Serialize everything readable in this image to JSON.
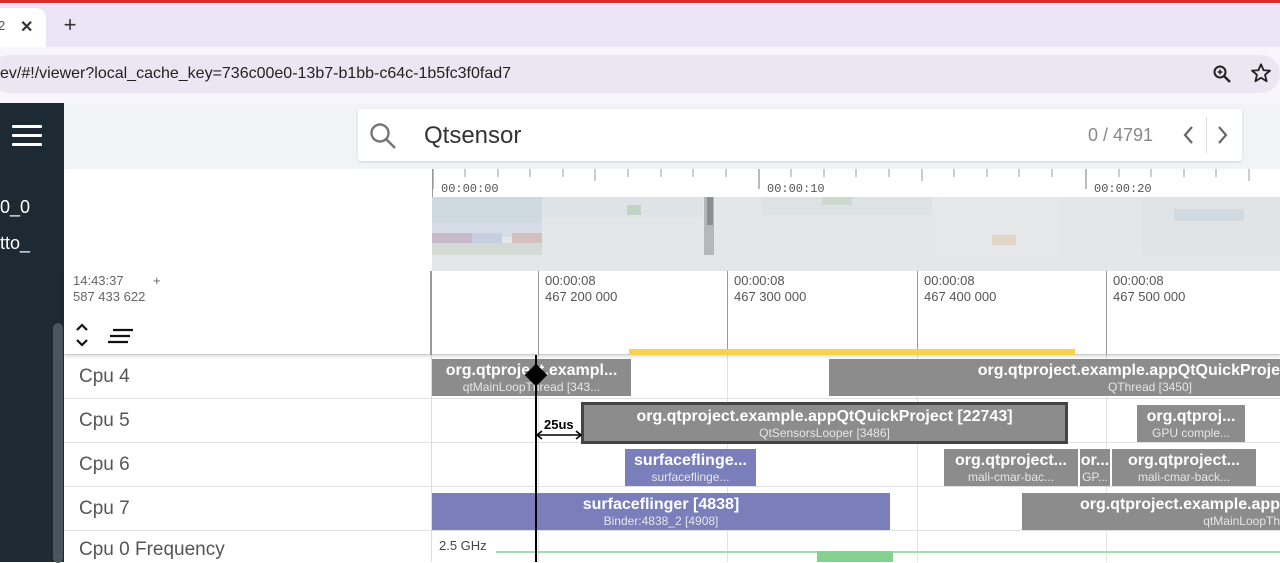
{
  "browser": {
    "tab_title": "2",
    "tab_close": "✕",
    "new_tab": "+",
    "url": "ev/#!/viewer?local_cache_key=736c00e0-13b7-b1bb-c64c-1b5fc3f0fad7",
    "accent": "#d93025"
  },
  "sidebar": {
    "line1": "0_0",
    "line2": "tto_"
  },
  "search": {
    "query": "Qtsensor",
    "count": "0 / 4791"
  },
  "overview": {
    "labels": [
      "00:00:00",
      "00:00:10",
      "00:00:20"
    ]
  },
  "timeline": {
    "abs_time_line1": "14:43:37",
    "abs_time_line2": "587 433 622",
    "plus": "+",
    "ticks": [
      {
        "line1": "00:00:08",
        "line2": "467 200 000"
      },
      {
        "line1": "00:00:08",
        "line2": "467 300 000"
      },
      {
        "line1": "00:00:08",
        "line2": "467 400 000"
      },
      {
        "line1": "00:00:08",
        "line2": "467 500 000"
      }
    ]
  },
  "tracks": [
    {
      "name": "Cpu 4"
    },
    {
      "name": "Cpu 5"
    },
    {
      "name": "Cpu 6"
    },
    {
      "name": "Cpu 7"
    },
    {
      "name": "Cpu 0 Frequency"
    }
  ],
  "slices": {
    "cpu4_a_t1": "org.qtproject.exampl...",
    "cpu4_a_t2": "qtMainLoopThread [343...",
    "cpu4_b_t1": "org.qtproject.example.appQtQuickProje",
    "cpu4_b_t2": "QThread [3450]",
    "cpu5_a_t1": "org.qtproject.example.appQtQuickProject [22743]",
    "cpu5_a_t2": "QtSensorsLooper [3486]",
    "cpu5_b_t1": "org.qtproj...",
    "cpu5_b_t2": "GPU comple...",
    "cpu6_a_t1": "surfaceflinge...",
    "cpu6_a_t2": "surfaceflinge...",
    "cpu6_b_t1": "org.qtproject...",
    "cpu6_b_t2": "mali-cmar-bac...",
    "cpu6_c_t1": "or...",
    "cpu6_c_t2": "GP...",
    "cpu6_d_t1": "org.qtproject...",
    "cpu6_d_t2": "mali-cmar-back...",
    "cpu7_a_t1": "surfaceflinger [4838]",
    "cpu7_a_t2": "Binder:4838_2 [4908]",
    "cpu7_b_t1": "org.qtproject.example.app",
    "cpu7_b_t2": "qtMainLoopTh"
  },
  "selection": {
    "duration": "25us"
  },
  "frequency": {
    "label": "2.5 GHz"
  },
  "colors": {
    "slice_gray": "#8c8c8c",
    "slice_blue": "#7a7fbb",
    "highlight": "#f6d34a",
    "freq": "#86d18f"
  }
}
